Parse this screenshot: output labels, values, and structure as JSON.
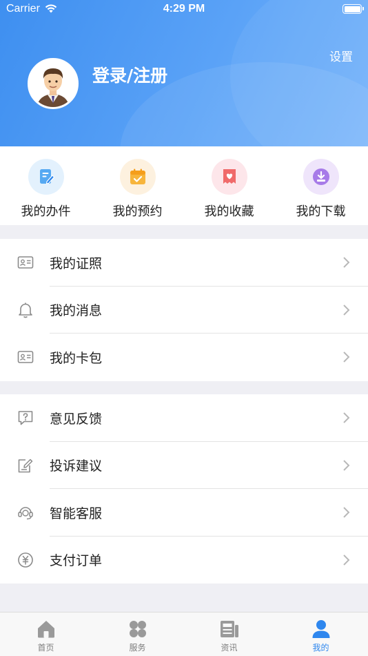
{
  "status_bar": {
    "carrier": "Carrier",
    "time": "4:29 PM"
  },
  "header": {
    "settings_label": "设置",
    "login_label": "登录/注册"
  },
  "quick_actions": [
    {
      "label": "我的办件",
      "icon": "document-edit-icon",
      "color": "#56a9f2"
    },
    {
      "label": "我的预约",
      "icon": "calendar-check-icon",
      "color": "#f7b53c"
    },
    {
      "label": "我的收藏",
      "icon": "favorite-heart-icon",
      "color": "#f06a6a"
    },
    {
      "label": "我的下载",
      "icon": "download-tray-icon",
      "color": "#a77be8"
    }
  ],
  "menu_group_1": [
    {
      "label": "我的证照",
      "icon": "id-card-icon"
    },
    {
      "label": "我的消息",
      "icon": "bell-icon"
    },
    {
      "label": "我的卡包",
      "icon": "card-wallet-icon"
    }
  ],
  "menu_group_2": [
    {
      "label": "意见反馈",
      "icon": "feedback-question-icon"
    },
    {
      "label": "投诉建议",
      "icon": "complaint-edit-icon"
    },
    {
      "label": "智能客服",
      "icon": "headset-icon"
    },
    {
      "label": "支付订单",
      "icon": "yuan-icon"
    }
  ],
  "tabs": [
    {
      "label": "首页",
      "icon": "home-icon",
      "active": false
    },
    {
      "label": "服务",
      "icon": "grid-icon",
      "active": false
    },
    {
      "label": "资讯",
      "icon": "news-icon",
      "active": false
    },
    {
      "label": "我的",
      "icon": "person-icon",
      "active": true
    }
  ],
  "colors": {
    "brand_blue": "#3e8ff0",
    "tab_active": "#2f87ee",
    "tab_inactive": "#7d7d7d"
  }
}
